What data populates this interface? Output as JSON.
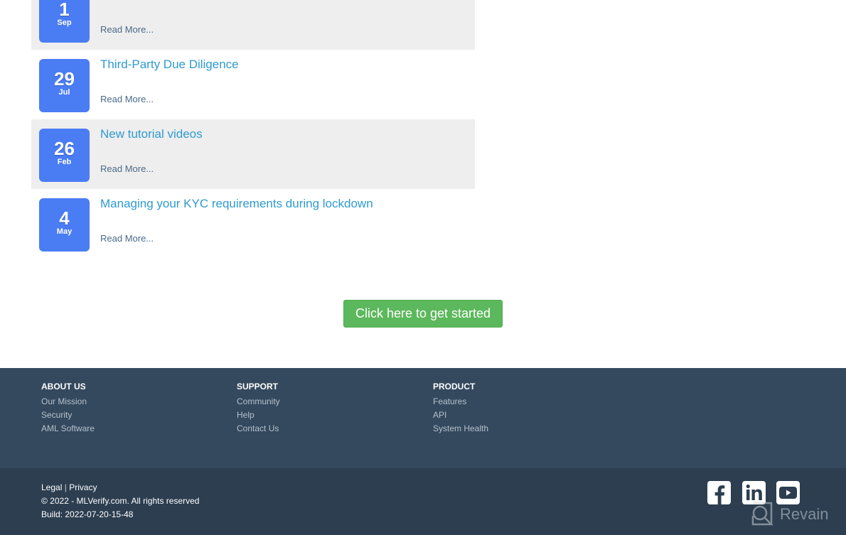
{
  "news": {
    "items": [
      {
        "day": "1",
        "month": "Sep",
        "title": "",
        "read_more": "Read More..."
      },
      {
        "day": "29",
        "month": "Jul",
        "title": "Third-Party Due Diligence",
        "read_more": "Read More..."
      },
      {
        "day": "26",
        "month": "Feb",
        "title": "New tutorial videos",
        "read_more": "Read More..."
      },
      {
        "day": "4",
        "month": "May",
        "title": "Managing your KYC requirements during lockdown",
        "read_more": "Read More..."
      }
    ]
  },
  "cta": {
    "label": "Click here to get started",
    "color": "#5cb85c"
  },
  "footer": {
    "columns": [
      {
        "heading": "ABOUT US",
        "links": [
          "Our Mission",
          "Security",
          "AML Software"
        ]
      },
      {
        "heading": "SUPPORT",
        "links": [
          "Community",
          "Help",
          "Contact Us"
        ]
      },
      {
        "heading": "PRODUCT",
        "links": [
          "Features",
          "API",
          "System Health"
        ]
      }
    ],
    "legal_link": "Legal",
    "separator": "|",
    "privacy_link": "Privacy",
    "copyright": "© 2022 - MLVerify.com. All rights reserved",
    "build": "Build: 2022-07-20-15-48",
    "social": [
      "facebook-icon",
      "linkedin-icon",
      "youtube-icon"
    ]
  },
  "watermark": {
    "text": "Revain"
  },
  "colors": {
    "badge": "#4a7cf4",
    "title_link": "#2e9ad0",
    "footer_top": "#34495e",
    "footer_bottom": "#2c3e50"
  }
}
